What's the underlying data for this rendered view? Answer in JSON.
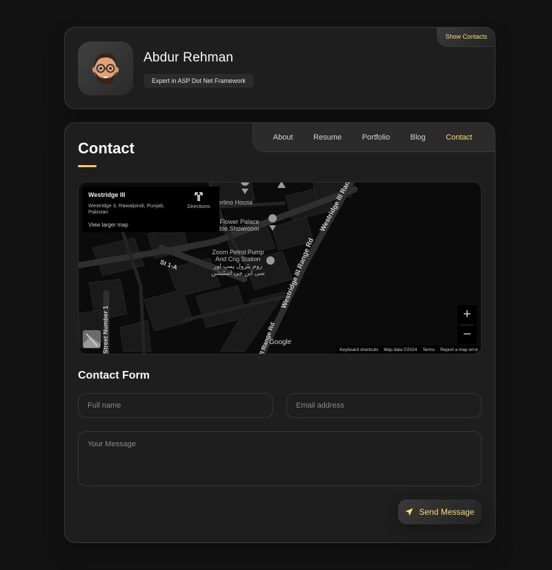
{
  "sidebar": {
    "name": "Abdur Rehman",
    "title": "Expert in ASP Dot Net Framework",
    "show_contacts_label": "Show Contacts"
  },
  "navbar": {
    "items": [
      {
        "label": "About",
        "active": false
      },
      {
        "label": "Resume",
        "active": false
      },
      {
        "label": "Portfolio",
        "active": false
      },
      {
        "label": "Blog",
        "active": false
      },
      {
        "label": "Contact",
        "active": true
      }
    ]
  },
  "contact": {
    "title": "Contact"
  },
  "map": {
    "place_name": "Westridge III",
    "place_address": "Westridge 3, Rawalpindi, Punjab, Pakistan",
    "view_larger": "View larger map",
    "directions_label": "Directions",
    "pois": [
      {
        "name": "erlino House"
      },
      {
        "name": "Flower Palace\narble Showroom"
      },
      {
        "name": "Zoom Petrol Pump\nAnd Cng Station\nزوم پٹرول پمپ اور\nسی این جی اسٹیشن"
      }
    ],
    "roads": [
      "St 1-A",
      "Westridge III Range Rd",
      "Westridge III Ran",
      "Street Number 1",
      "III Range Rd"
    ],
    "zoom_in": "+",
    "zoom_out": "−",
    "google_label": "Google",
    "footer": {
      "shortcuts": "Keyboard shortcuts",
      "map_data": "Map data ©2024",
      "terms": "Terms",
      "report": "Report a map error"
    }
  },
  "form": {
    "title": "Contact Form",
    "fullname_placeholder": "Full name",
    "email_placeholder": "Email address",
    "message_placeholder": "Your Message",
    "send_label": "Send Message"
  },
  "colors": {
    "background": "#121212",
    "card": "#1e1e1f",
    "accent": "#ffdb70"
  }
}
